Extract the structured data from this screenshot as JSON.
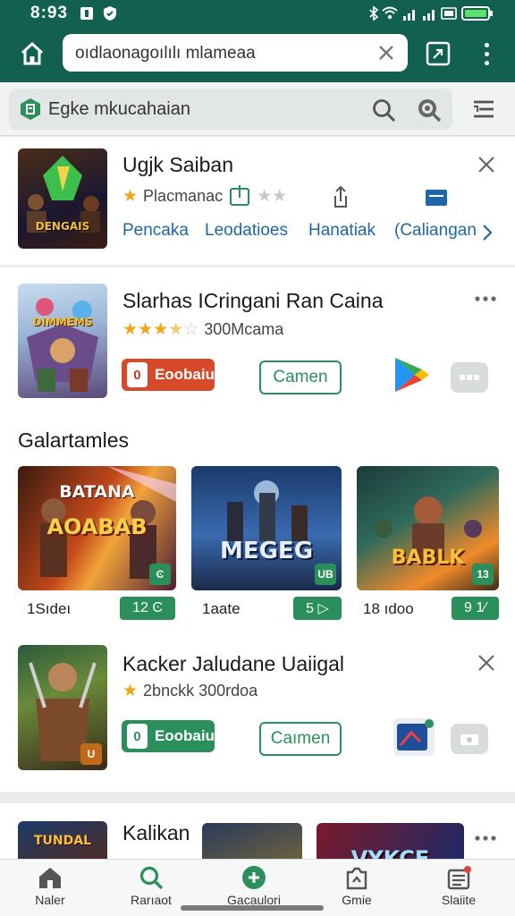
{
  "status_bar": {
    "time": "8:93"
  },
  "browser": {
    "url": "oıdlaonagoılılı mlameaa"
  },
  "search": {
    "query": "Egke mkucahaian"
  },
  "app1": {
    "title": "Ugjk Saiban",
    "rating_text": "Placmanac",
    "links": [
      "Pencaka",
      "Leodatioes",
      "Hanatiak",
      "(Caliangan"
    ],
    "thumb_text": "DENGAIS"
  },
  "app2": {
    "title": "Slarhas ICringani Ran Caina",
    "rating_text": "300Mcama",
    "stars": 3.5,
    "install_label": "Eoobaiu",
    "install_badge": "0",
    "open_label": "Camen",
    "thumb_text": "DIMMEMS"
  },
  "gallery": {
    "title": "Galartamles",
    "items": [
      {
        "name": "1Sıdeı",
        "badge": "12 Ͼ",
        "thumb_top": "BATANA",
        "thumb_main": "AOABAB",
        "tag": "Ͼ"
      },
      {
        "name": "1aate",
        "badge": "5 ▷",
        "thumb_top": "",
        "thumb_main": "MEGEG",
        "tag": "UB"
      },
      {
        "name": "18 ıdoo",
        "badge": "9 1⁄",
        "thumb_top": "",
        "thumb_main": "BABLK",
        "tag": "13"
      }
    ]
  },
  "app3": {
    "title": "Kacker Jaludane Uaiigal",
    "rating_text": "2bnckk  300rdoa",
    "install_label": "Eoobaiu",
    "install_badge": "0",
    "open_label": "Caımen",
    "thumb_tag": "U"
  },
  "app4": {
    "title": "Kalikan",
    "thumb_text": "TUNDAL",
    "thumb_text_2": "VYKCE"
  },
  "bottom_nav": [
    {
      "label": "Naler",
      "icon": "home-icon"
    },
    {
      "label": "Rarıaot",
      "icon": "search-icon"
    },
    {
      "label": "Gacaulori",
      "icon": "add-circle-icon"
    },
    {
      "label": "Gmie",
      "icon": "share-icon"
    },
    {
      "label": "Slaiite",
      "icon": "list-icon"
    }
  ],
  "colors": {
    "header": "#12604f",
    "accent_green": "#2a8f5b",
    "install_red": "#d64a2a",
    "link_blue": "#1e66a6",
    "star": "#f2a516"
  }
}
